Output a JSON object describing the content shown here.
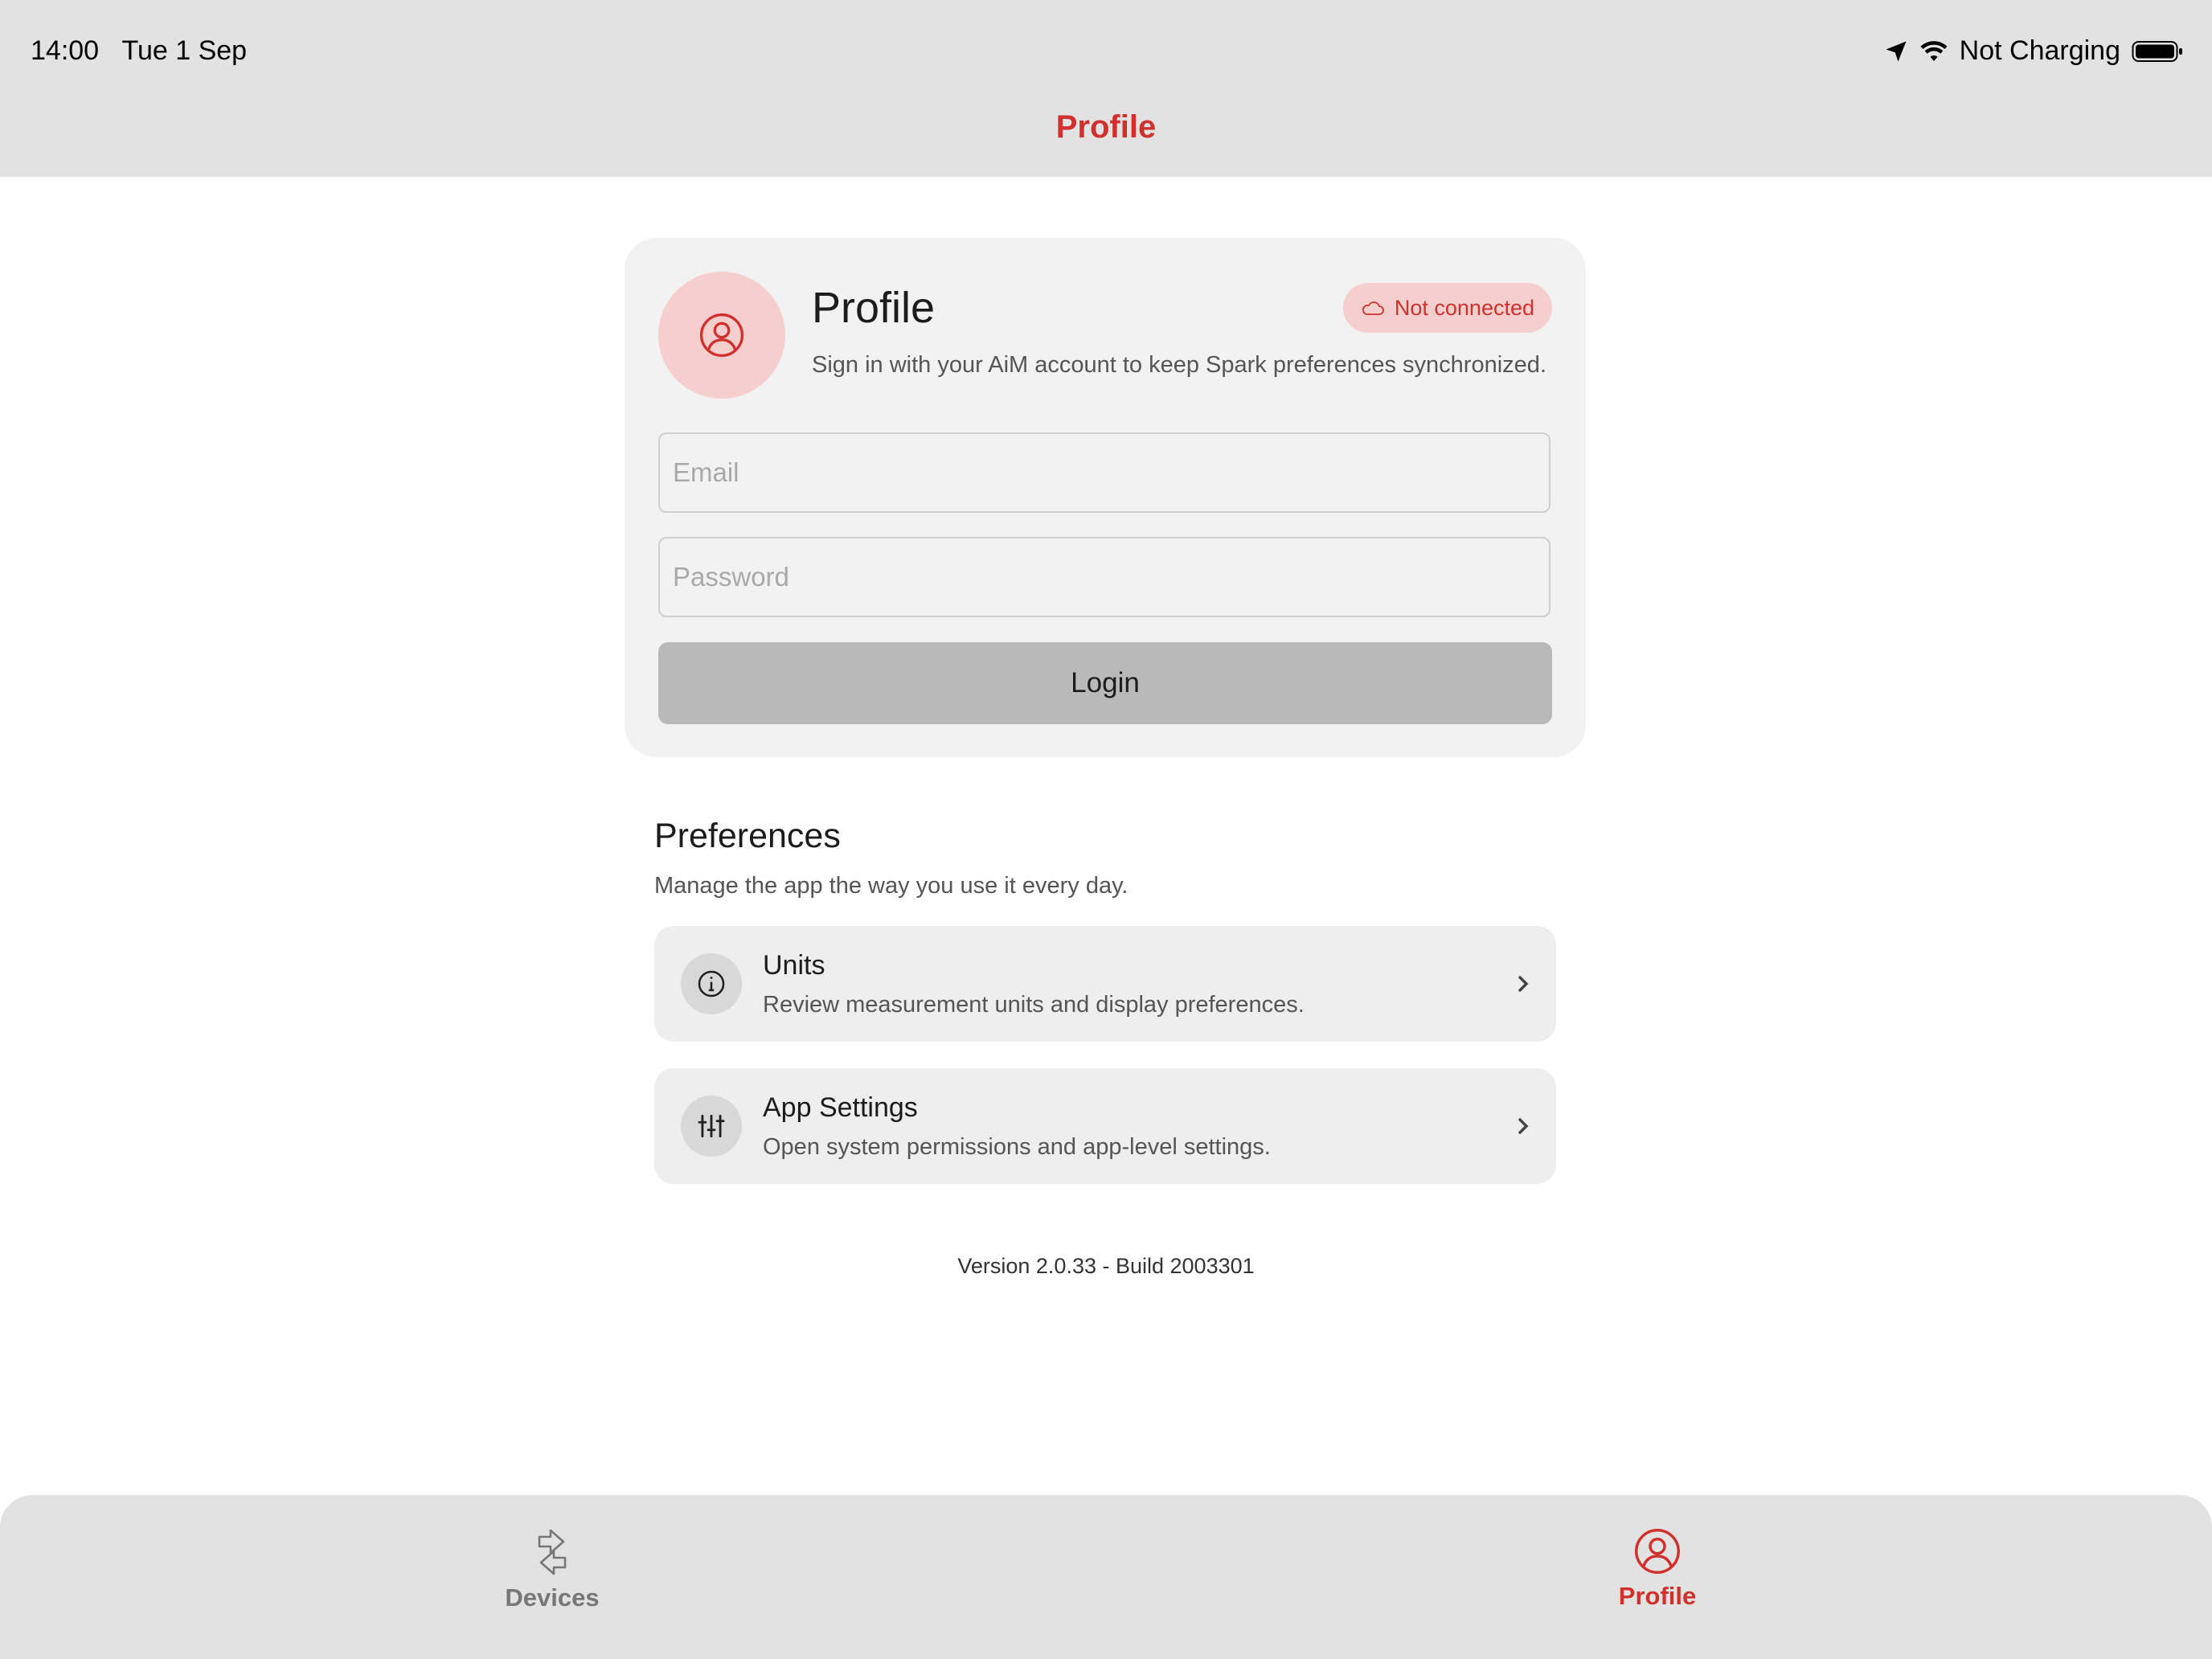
{
  "status_bar": {
    "time": "14:00",
    "date": "Tue 1 Sep",
    "battery_text": "Not Charging",
    "icons": [
      "location-arrow-icon",
      "wifi-icon",
      "battery-icon"
    ]
  },
  "nav": {
    "title": "Profile"
  },
  "profile_card": {
    "title": "Profile",
    "subtitle": "Sign in with your AiM account to keep Spark preferences synchronized.",
    "badge": "Not connected",
    "email_placeholder": "Email",
    "email_value": "",
    "password_placeholder": "Password",
    "password_value": "",
    "login_label": "Login"
  },
  "preferences": {
    "title": "Preferences",
    "subtitle": "Manage the app the way you use it every day.",
    "items": [
      {
        "title": "Units",
        "subtitle": "Review measurement units and display preferences.",
        "icon": "info-icon"
      },
      {
        "title": "App Settings",
        "subtitle": "Open system permissions and app-level settings.",
        "icon": "sliders-icon"
      }
    ]
  },
  "version": "Version 2.0.33 - Build 2003301",
  "tabs": [
    {
      "label": "Devices",
      "icon": "transfer-arrows-icon",
      "active": false
    },
    {
      "label": "Profile",
      "icon": "user-circle-icon",
      "active": true
    }
  ],
  "colors": {
    "accent": "#d0312d",
    "accent_light": "#f5cfce",
    "bar_background": "#e2e2e2",
    "card_background": "#f2f2f2",
    "button_disabled": "#b9b9b9"
  }
}
